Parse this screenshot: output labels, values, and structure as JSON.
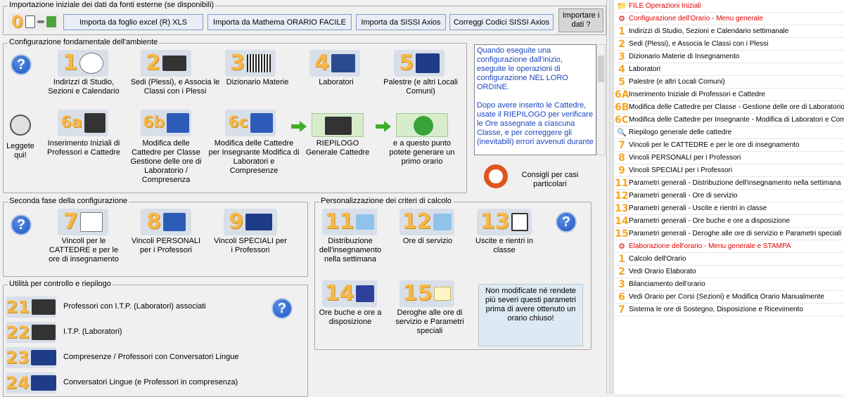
{
  "import": {
    "title": "Importazione iniziale dei dati da fonti esterne (se disponibili)",
    "badge": "0",
    "btn_excel": "Importa da foglio excel (R) XLS",
    "btn_mathema": "Importa da Mathema ORARIO FACILE",
    "btn_sissi": "Importa da SISSI Axios",
    "btn_codici": "Correggi Codici SISSI Axios",
    "btn_importare": "Importare i dati ?"
  },
  "config": {
    "title": "Configurazione fondamentale dell'ambiente",
    "help": "?",
    "items": [
      {
        "num": "1",
        "label": "Indirizzi di Studio, Sezioni e Calendario"
      },
      {
        "num": "2",
        "label": "Sedi (Plessi), e Associa le Classi con i Plessi"
      },
      {
        "num": "3",
        "label": "Dizionario Materie"
      },
      {
        "num": "4",
        "label": "Laboratori"
      },
      {
        "num": "5",
        "label": "Palestre (e altri Locali Comuni)"
      }
    ],
    "leggete": "Leggete qui!",
    "items2": [
      {
        "num": "6a",
        "label": "Inserimento Iniziali di Professori e Cattedre"
      },
      {
        "num": "6b",
        "label": "Modifica delle Cattedre per Classe Gestione delle ore di Laboratorio / Compresenza"
      },
      {
        "num": "6c",
        "label": "Modifica delle Cattedre per Insegnante Modifica di Laboratori e Compresenze"
      }
    ],
    "riepilogo": "RIEPILOGO Generale Cattedre",
    "generare": "e a questo punto potete generare un primo orario",
    "memo": "Quando eseguite una configurazione dall'inizio, eseguite le operazioni di configurazione NEL LORO ORDINE.\n\nDopo avere inserito le Cattedre, usate il RIEPILOGO per verificare le Ore assegnate a ciascuna Classe, e per correggere gli (inevitabili) errori avvenuti durante",
    "consigli": "Consigli per casi particolari"
  },
  "seconda": {
    "title": "Seconda fase della configurazione",
    "help": "?",
    "items": [
      {
        "num": "7",
        "label": "Vincoli per le CATTEDRE e per le ore di insegnamento"
      },
      {
        "num": "8",
        "label": "Vincoli PERSONALI per i Professori"
      },
      {
        "num": "9",
        "label": "Vincoli SPECIALI per i Professori"
      }
    ]
  },
  "personal": {
    "title": "Personalizzazione dei criteri di calcolo",
    "help": "?",
    "items": [
      {
        "num": "11",
        "label": "Distribuzione dell'insegnamento nella settimana"
      },
      {
        "num": "12",
        "label": "Ore di servizio"
      },
      {
        "num": "13",
        "label": "Uscite e rientri in classe"
      },
      {
        "num": "14",
        "label": "Ore buche e ore a disposizione"
      },
      {
        "num": "15",
        "label": "Deroghe alle ore di servizio e Parametri speciali"
      }
    ],
    "note": "Non modificate né rendete più severi questi parametri prima di avere ottenuto un orario chiuso!"
  },
  "utility": {
    "title": "Utilità per controllo e riepilogo",
    "help": "?",
    "items": [
      {
        "num": "21",
        "label": "Professori con I.T.P. (Laboratori) associati"
      },
      {
        "num": "22",
        "label": "I.T.P. (Laboratori)"
      },
      {
        "num": "23",
        "label": "Compresenze / Professori con Conversatori Lingue"
      },
      {
        "num": "24",
        "label": "Conversatori Lingue (e Professori in compresenza)"
      }
    ]
  },
  "menu": {
    "items": [
      {
        "n": "",
        "icon": "📁",
        "label": "FILE Operazioni Iniziali",
        "red": true
      },
      {
        "n": "",
        "icon": "⚙",
        "label": "Configurazione dell'Orario - Menu generale",
        "red": true
      },
      {
        "n": "1",
        "label": "Indirizzi di Studio, Sezioni e Calendario settimanale"
      },
      {
        "n": "2",
        "label": "Sedi (Plessi), e Associa le Classi con i Plessi"
      },
      {
        "n": "3",
        "label": "Dizionario Materie di Insegnamento"
      },
      {
        "n": "4",
        "label": "Laboratori"
      },
      {
        "n": "5",
        "label": "Palestre (e altri Locali Comuni)"
      },
      {
        "n": "6A",
        "label": "Inserimento Iniziale di Professori e Cattedre"
      },
      {
        "n": "6B",
        "label": "Modifica delle Cattedre per Classe - Gestione delle ore di Laboratorio / ..."
      },
      {
        "n": "6C",
        "label": "Modifica delle Cattedre per Insegnante - Modifica di Laboratori e Comp..."
      },
      {
        "n": "",
        "icon": "🔍",
        "label": "Riepilogo generale delle cattedre"
      },
      {
        "n": "7",
        "label": "Vincoli per le CATTEDRE e per le ore di insegnamento"
      },
      {
        "n": "8",
        "label": "Vincoli PERSONALI per i Professori"
      },
      {
        "n": "9",
        "label": "Vincoli SPECIALI  per i Professori"
      },
      {
        "n": "11",
        "label": "Parametri generali - Distribuzione dell'insegnamento nella settimana"
      },
      {
        "n": "12",
        "label": "Parametri generali - Ore di servizio"
      },
      {
        "n": "13",
        "label": "Parametri generali - Uscite e rientri in classe"
      },
      {
        "n": "14",
        "label": "Parametri generali - Ore buche e ore a disposizione"
      },
      {
        "n": "15",
        "label": "Parametri generali - Deroghe alle ore di servizio e Parametri speciali"
      },
      {
        "n": "",
        "icon": "⚙",
        "label": "Elaborazione dell'orario - Menu generale e STAMPA",
        "red": true
      },
      {
        "n": "1",
        "label": "Calcolo dell'Orario"
      },
      {
        "n": "2",
        "label": "Vedi Orario Elaborato"
      },
      {
        "n": "3",
        "label": "Bilanciamento dell'orario"
      },
      {
        "n": "6",
        "label": "Vedi Orario per Corsi (Sezioni) e Modifica Orario Manualmente"
      },
      {
        "n": "7",
        "label": "Sistema le ore di Sostegno, Disposizione e Ricevimento"
      }
    ]
  }
}
